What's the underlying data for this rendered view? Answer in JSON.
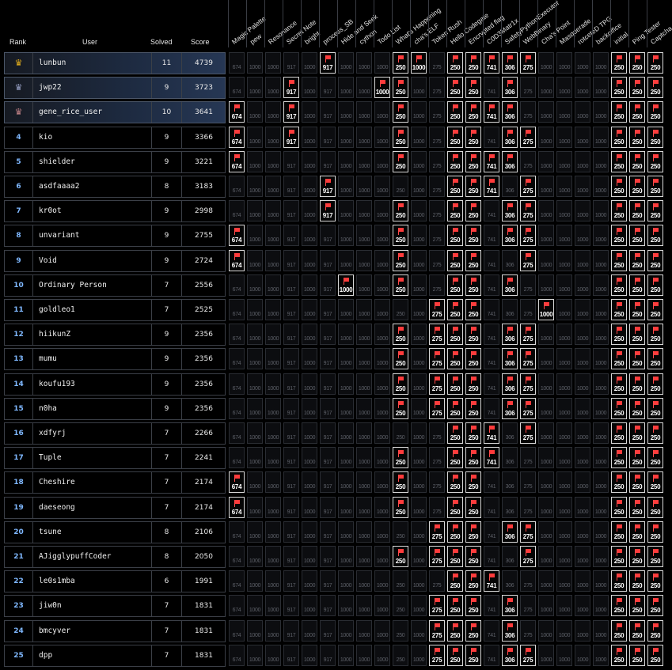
{
  "headers": {
    "rank": "Rank",
    "user": "User",
    "solved": "Solved",
    "score": "Score"
  },
  "colors": {
    "accent_rank": "#7fb8ff",
    "flag": "#ff3b3b",
    "gold_crown": "#e8b21c",
    "silver_crown": "#9aa3c8",
    "bronze_crown": "#c7858a"
  },
  "challenges": [
    {
      "name": "Magic Palette",
      "points": 674
    },
    {
      "name": "pew",
      "points": 1000
    },
    {
      "name": "Resonance",
      "points": 1000
    },
    {
      "name": "Secret Note",
      "points": 917
    },
    {
      "name": "bright",
      "points": 1000
    },
    {
      "name": "process_SB",
      "points": 917
    },
    {
      "name": "Hide and Seek",
      "points": 1000
    },
    {
      "name": "cython",
      "points": 1000
    },
    {
      "name": "Todo List",
      "points": 1000
    },
    {
      "name": "What's Happening",
      "points": 250
    },
    {
      "name": "cha's ELF",
      "points": 1000
    },
    {
      "name": "Token Rush",
      "points": 275
    },
    {
      "name": "Hello Codegate",
      "points": 250
    },
    {
      "name": "Encrypted flag",
      "points": 250
    },
    {
      "name": "C0D3Matr1x",
      "points": 741
    },
    {
      "name": "SafetyPythonExecutor",
      "points": 306
    },
    {
      "name": "WebBinary",
      "points": 275
    },
    {
      "name": "Cha's Point",
      "points": 1000
    },
    {
      "name": "Masquerade",
      "points": 1000
    },
    {
      "name": "rotceteD TPG",
      "points": 1000
    },
    {
      "name": "backoffice",
      "points": 1000
    },
    {
      "name": "initial",
      "points": 250
    },
    {
      "name": "Ping Tester",
      "points": 250
    },
    {
      "name": "Captcha",
      "points": 250
    }
  ],
  "rows": [
    {
      "rank": "",
      "crown": "gold-crown-icon",
      "user": "lunbun",
      "solved": "11",
      "score": "4739",
      "top": true,
      "solved_idx": [
        5,
        9,
        10,
        12,
        13,
        14,
        15,
        16,
        21,
        22,
        23
      ]
    },
    {
      "rank": "",
      "crown": "silver-crown-icon",
      "user": "jwp22",
      "solved": "9",
      "score": "3723",
      "top": true,
      "solved_idx": [
        3,
        8,
        9,
        12,
        13,
        15,
        21,
        22,
        23
      ]
    },
    {
      "rank": "",
      "crown": "bronze-crown-icon",
      "user": "gene_rice_user",
      "solved": "10",
      "score": "3641",
      "top": true,
      "solved_idx": [
        0,
        3,
        9,
        12,
        13,
        14,
        15,
        21,
        22,
        23
      ]
    },
    {
      "rank": "4",
      "user": "kio",
      "solved": "9",
      "score": "3366",
      "solved_idx": [
        0,
        3,
        9,
        12,
        13,
        15,
        16,
        21,
        22,
        23
      ]
    },
    {
      "rank": "5",
      "user": "shielder",
      "solved": "9",
      "score": "3221",
      "solved_idx": [
        0,
        9,
        12,
        13,
        14,
        15,
        21,
        22,
        23
      ]
    },
    {
      "rank": "6",
      "user": "asdfaaaa2",
      "solved": "8",
      "score": "3183",
      "solved_idx": [
        5,
        12,
        13,
        14,
        16,
        21,
        22,
        23
      ]
    },
    {
      "rank": "7",
      "user": "kr0ot",
      "solved": "9",
      "score": "2998",
      "solved_idx": [
        5,
        9,
        12,
        13,
        15,
        16,
        21,
        22,
        23
      ]
    },
    {
      "rank": "8",
      "user": "unvariant",
      "solved": "9",
      "score": "2755",
      "solved_idx": [
        0,
        9,
        12,
        13,
        15,
        16,
        21,
        22,
        23
      ]
    },
    {
      "rank": "9",
      "user": "Void",
      "solved": "9",
      "score": "2724",
      "solved_idx": [
        0,
        9,
        12,
        13,
        16,
        21,
        22,
        23
      ]
    },
    {
      "rank": "10",
      "user": "Ordinary Person",
      "solved": "7",
      "score": "2556",
      "solved_idx": [
        6,
        9,
        12,
        13,
        15,
        21,
        22,
        23
      ]
    },
    {
      "rank": "11",
      "user": "goldleo1",
      "solved": "7",
      "score": "2525",
      "solved_idx": [
        11,
        12,
        13,
        17,
        21,
        22,
        23
      ]
    },
    {
      "rank": "12",
      "user": "hiikunZ",
      "solved": "9",
      "score": "2356",
      "solved_idx": [
        9,
        11,
        12,
        13,
        15,
        16,
        21,
        22,
        23
      ]
    },
    {
      "rank": "13",
      "user": "mumu",
      "solved": "9",
      "score": "2356",
      "solved_idx": [
        9,
        11,
        12,
        13,
        15,
        16,
        21,
        22,
        23
      ]
    },
    {
      "rank": "14",
      "user": "koufu193",
      "solved": "9",
      "score": "2356",
      "solved_idx": [
        9,
        11,
        12,
        13,
        15,
        16,
        21,
        22,
        23
      ]
    },
    {
      "rank": "15",
      "user": "n0ha",
      "solved": "9",
      "score": "2356",
      "solved_idx": [
        9,
        11,
        12,
        13,
        15,
        16,
        21,
        22,
        23
      ]
    },
    {
      "rank": "16",
      "user": "xdfyrj",
      "solved": "7",
      "score": "2266",
      "solved_idx": [
        12,
        13,
        14,
        16,
        21,
        22,
        23
      ]
    },
    {
      "rank": "17",
      "user": "Tuple",
      "solved": "7",
      "score": "2241",
      "solved_idx": [
        9,
        12,
        13,
        14,
        21,
        22,
        23
      ]
    },
    {
      "rank": "18",
      "user": "Cheshire",
      "solved": "7",
      "score": "2174",
      "solved_idx": [
        0,
        9,
        12,
        13,
        21,
        22,
        23
      ]
    },
    {
      "rank": "19",
      "user": "daeseong",
      "solved": "7",
      "score": "2174",
      "solved_idx": [
        0,
        9,
        12,
        13,
        21,
        22,
        23
      ]
    },
    {
      "rank": "20",
      "user": "tsune",
      "solved": "8",
      "score": "2106",
      "solved_idx": [
        11,
        12,
        13,
        15,
        16,
        21,
        22,
        23
      ]
    },
    {
      "rank": "21",
      "user": "AJigglypuffCoder",
      "solved": "8",
      "score": "2050",
      "solved_idx": [
        9,
        11,
        12,
        13,
        16,
        21,
        22,
        23
      ]
    },
    {
      "rank": "22",
      "user": "le0s1mba",
      "solved": "6",
      "score": "1991",
      "solved_idx": [
        12,
        13,
        14,
        21,
        22,
        23
      ]
    },
    {
      "rank": "23",
      "user": "jiw0n",
      "solved": "7",
      "score": "1831",
      "solved_idx": [
        11,
        12,
        13,
        15,
        21,
        22,
        23
      ]
    },
    {
      "rank": "24",
      "user": "bmcyver",
      "solved": "7",
      "score": "1831",
      "solved_idx": [
        11,
        12,
        13,
        15,
        21,
        22,
        23
      ]
    },
    {
      "rank": "25",
      "user": "dpp",
      "solved": "7",
      "score": "1831",
      "solved_idx": [
        11,
        12,
        13,
        15,
        16,
        21,
        22,
        23
      ]
    }
  ]
}
